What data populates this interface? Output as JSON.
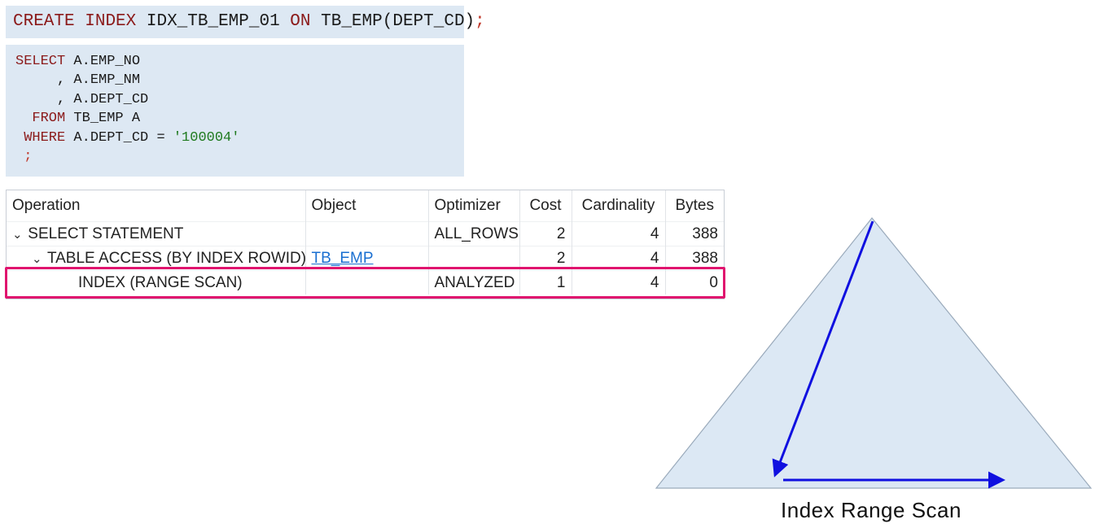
{
  "create_sql": {
    "kw_create": "CREATE",
    "kw_index": "INDEX",
    "index_name": "IDX_TB_EMP_01",
    "kw_on": "ON",
    "target": "TB_EMP(DEPT_CD)",
    "semicolon": ";"
  },
  "select_sql": {
    "kw_select": "SELECT",
    "col1": "A.EMP_NO",
    "col2": ", A.EMP_NM",
    "col3": ", A.DEPT_CD",
    "kw_from": "FROM",
    "from_table": "TB_EMP A",
    "kw_where": "WHERE",
    "where_cond": "A.DEPT_CD = ",
    "where_value": "'100004'",
    "semicolon": ";"
  },
  "plan": {
    "headers": [
      "Operation",
      "Object",
      "Optimizer",
      "Cost",
      "Cardinality",
      "Bytes"
    ],
    "rows": [
      {
        "operation": "SELECT STATEMENT",
        "object": "",
        "optimizer": "ALL_ROWS",
        "cost": "2",
        "cardinality": "4",
        "bytes": "388"
      },
      {
        "operation": "TABLE ACCESS (BY INDEX ROWID)",
        "object": "TB_EMP",
        "optimizer": "",
        "cost": "2",
        "cardinality": "4",
        "bytes": "388"
      },
      {
        "operation": "INDEX (RANGE SCAN)",
        "object": "",
        "optimizer": "ANALYZED",
        "cost": "1",
        "cardinality": "4",
        "bytes": "0"
      }
    ]
  },
  "diagram": {
    "caption": "Index Range Scan",
    "colors": {
      "triangle_fill": "#dce8f4",
      "triangle_stroke": "#9aaabb",
      "arrow": "#1010e0",
      "highlight": "#e0146e"
    }
  }
}
